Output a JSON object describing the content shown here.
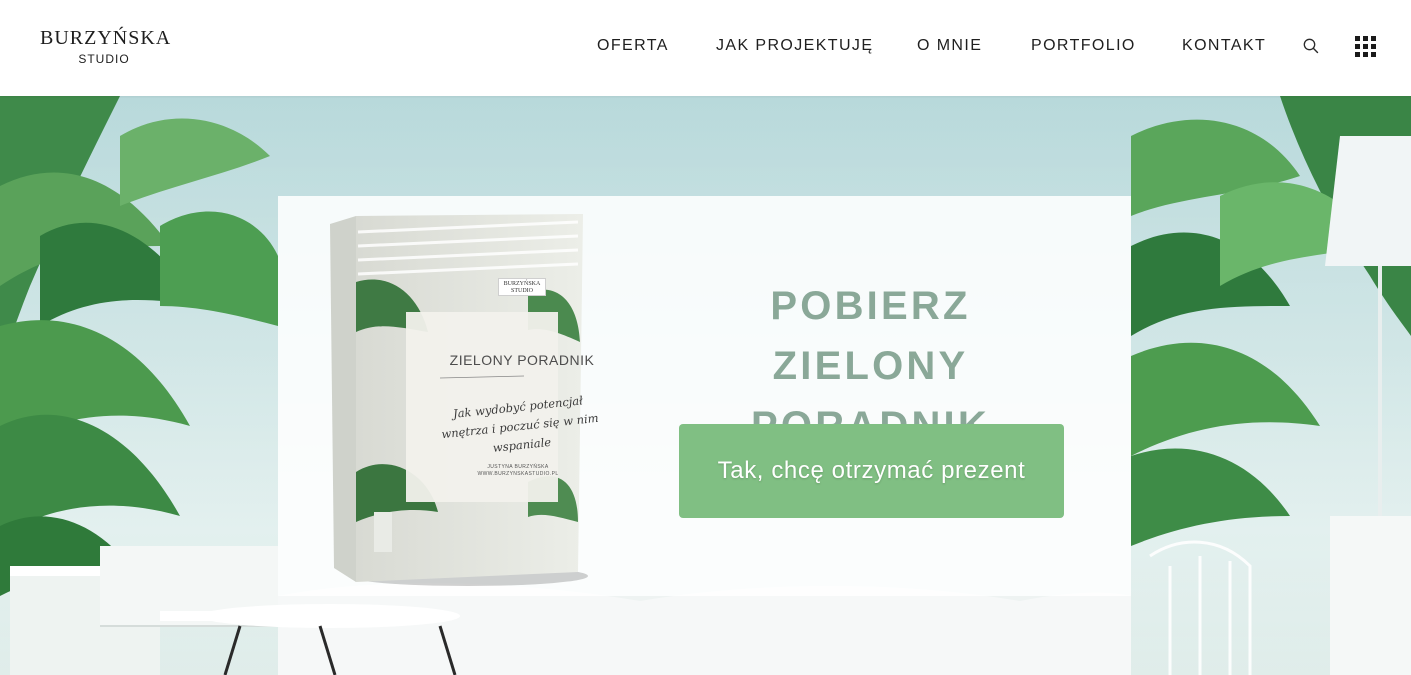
{
  "header": {
    "logo_main": "BURZYŃSKA",
    "logo_sub": "STUDIO",
    "nav": [
      {
        "label": "OFERTA"
      },
      {
        "label": "JAK PROJEKTUJĘ"
      },
      {
        "label": "O MNIE"
      },
      {
        "label": "PORTFOLIO"
      },
      {
        "label": "KONTAKT"
      }
    ],
    "search_icon": "search-icon",
    "menu_icon": "grid-menu-icon"
  },
  "hero": {
    "book": {
      "brand": "BURZYŃSKA STUDIO",
      "title": "ZIELONY PORADNIK",
      "subtitle": "Jak wydobyć potencjał wnętrza i poczuć się w nim wspaniale",
      "author": "JUSTYNA BURZYŃSKA",
      "website": "WWW.BURZYNSKASTUDIO.PL"
    },
    "heading": "POBIERZ ZIELONY PORADNIK",
    "cta_label": "Tak, chcę otrzymać prezent"
  },
  "colors": {
    "heading": "#8aa898",
    "cta_background": "#80bf83",
    "cta_text": "#ffffff",
    "header_background": "#ffffff",
    "nav_text": "#1f1f1f"
  }
}
